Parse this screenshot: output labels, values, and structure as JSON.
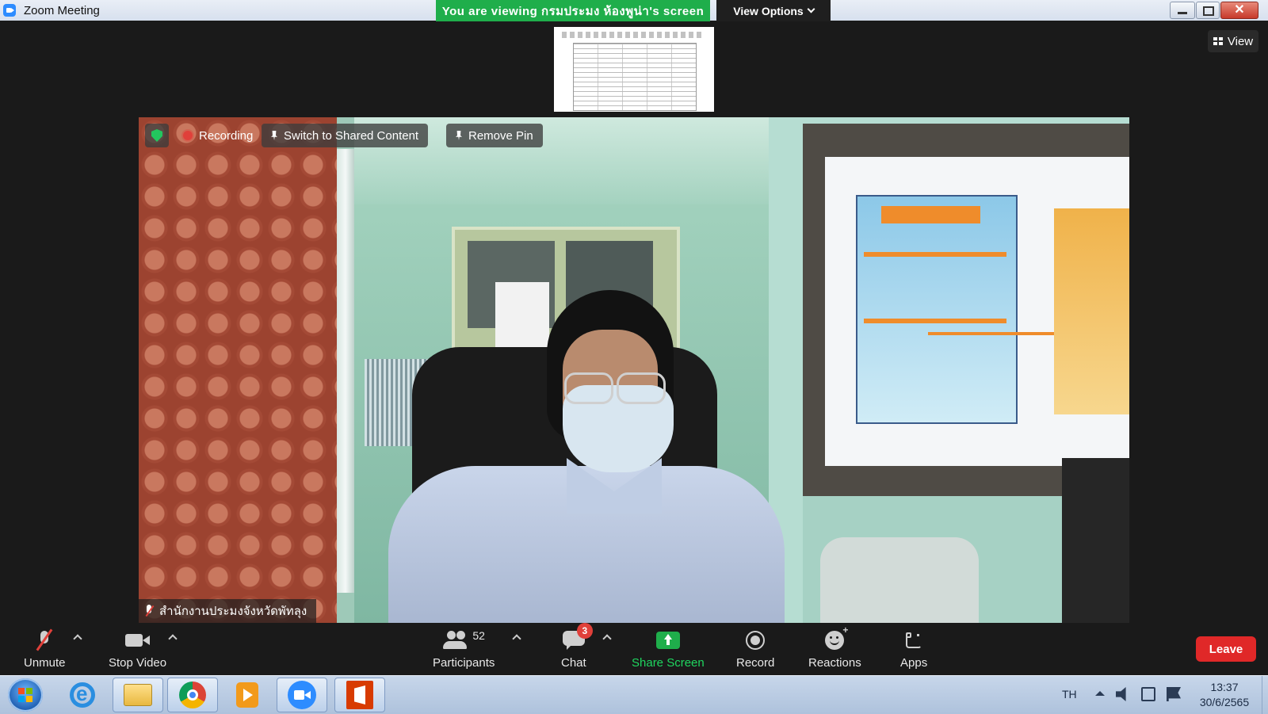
{
  "window": {
    "title": "Zoom Meeting",
    "banner": "You are viewing กรมประมง ห้องพูน่า's screen",
    "view_options": "View Options",
    "close_glyph": "✕"
  },
  "top_right": {
    "view_label": "View"
  },
  "video": {
    "recording_label": "Recording",
    "switch_shared_label": "Switch to Shared Content",
    "remove_pin_label": "Remove Pin",
    "participant_name": "สำนักงานประมงจังหวัดพัทลุง"
  },
  "toolbar": {
    "unmute": "Unmute",
    "stop_video": "Stop Video",
    "participants": "Participants",
    "participants_count": "52",
    "chat": "Chat",
    "chat_badge": "3",
    "share_screen": "Share Screen",
    "record": "Record",
    "reactions": "Reactions",
    "apps": "Apps",
    "leave": "Leave"
  },
  "taskbar": {
    "language": "TH",
    "time": "13:37",
    "date": "30/6/2565",
    "apps": [
      "start-icon",
      "internet-explorer-icon",
      "file-explorer-icon",
      "chrome-icon",
      "media-player-icon",
      "zoom-icon",
      "office-icon"
    ]
  },
  "colors": {
    "banner_green": "#1fae4b",
    "leave_red": "#e02828",
    "zoom_blue": "#2d8cff"
  }
}
